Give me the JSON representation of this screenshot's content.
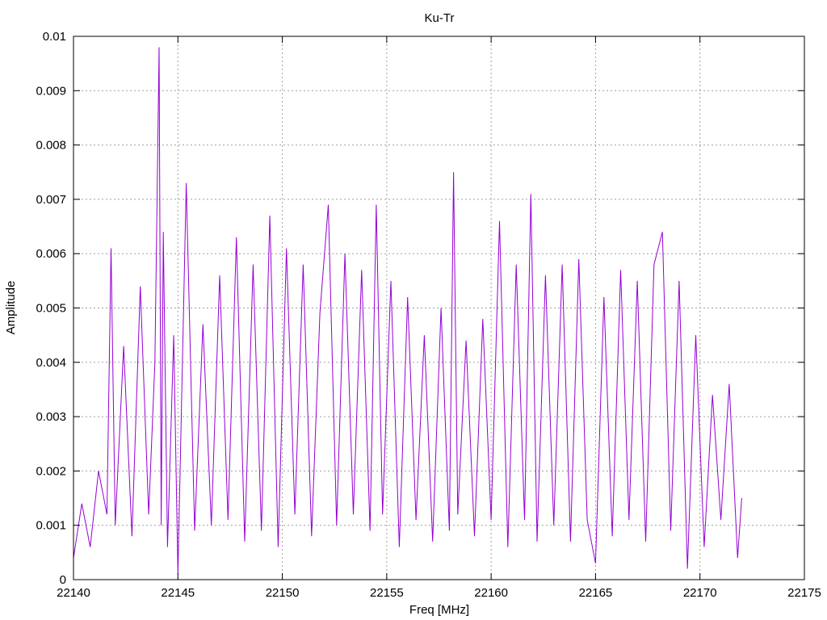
{
  "chart_data": {
    "type": "line",
    "title": "Ku-Tr",
    "xlabel": "Freq [MHz]",
    "ylabel": "Amplitude",
    "xlim": [
      22140,
      22175
    ],
    "ylim": [
      0,
      0.01
    ],
    "grid": true,
    "legend": "none",
    "x_ticks": [
      "22140",
      "22145",
      "22150",
      "22155",
      "22160",
      "22165",
      "22170",
      "22175"
    ],
    "y_ticks": [
      "0",
      "0.001",
      "0.002",
      "0.003",
      "0.004",
      "0.005",
      "0.006",
      "0.007",
      "0.008",
      "0.009",
      "0.01"
    ],
    "series_color": "#9400d3",
    "series": [
      {
        "x": [
          22140.0,
          22140.4,
          22140.8,
          22141.2,
          22141.6,
          22141.8,
          22142.0,
          22142.4,
          22142.8,
          22143.2,
          22143.6,
          22143.9,
          22144.1,
          22144.2,
          22144.3,
          22144.5,
          22144.8,
          22145.0,
          22145.4,
          22145.8,
          22146.2,
          22146.6,
          22147.0,
          22147.4,
          22147.8,
          22148.2,
          22148.6,
          22149.0,
          22149.4,
          22149.8,
          22150.2,
          22150.6,
          22151.0,
          22151.4,
          22151.8,
          22152.2,
          22152.6,
          22153.0,
          22153.4,
          22153.8,
          22154.2,
          22154.5,
          22154.8,
          22155.2,
          22155.6,
          22156.0,
          22156.4,
          22156.8,
          22157.2,
          22157.6,
          22158.0,
          22158.2,
          22158.4,
          22158.8,
          22159.2,
          22159.6,
          22160.0,
          22160.4,
          22160.8,
          22161.2,
          22161.6,
          22161.9,
          22162.2,
          22162.6,
          22163.0,
          22163.4,
          22163.8,
          22164.2,
          22164.6,
          22165.0,
          22165.4,
          22165.8,
          22166.2,
          22166.6,
          22167.0,
          22167.4,
          22167.8,
          22168.2,
          22168.6,
          22169.0,
          22169.4,
          22169.8,
          22170.2,
          22170.6,
          22171.0,
          22171.4,
          22171.8,
          22172.0
        ],
        "y": [
          0.0004,
          0.0014,
          0.0006,
          0.002,
          0.0012,
          0.0061,
          0.001,
          0.0043,
          0.0008,
          0.0054,
          0.0012,
          0.004,
          0.0098,
          0.001,
          0.0064,
          0.0006,
          0.0045,
          0.0001,
          0.0073,
          0.0009,
          0.0047,
          0.001,
          0.0056,
          0.0011,
          0.0063,
          0.0007,
          0.0058,
          0.0009,
          0.0067,
          0.0006,
          0.0061,
          0.0012,
          0.0058,
          0.0008,
          0.0049,
          0.0069,
          0.001,
          0.006,
          0.0012,
          0.0057,
          0.0009,
          0.0069,
          0.0012,
          0.0055,
          0.0006,
          0.0052,
          0.0011,
          0.0045,
          0.0007,
          0.005,
          0.0009,
          0.0075,
          0.0012,
          0.0044,
          0.0008,
          0.0048,
          0.0011,
          0.0066,
          0.0006,
          0.0058,
          0.0011,
          0.0071,
          0.0007,
          0.0056,
          0.001,
          0.0058,
          0.0007,
          0.0059,
          0.0011,
          0.0003,
          0.0052,
          0.0008,
          0.0057,
          0.0011,
          0.0055,
          0.0007,
          0.0058,
          0.0064,
          0.0009,
          0.0055,
          0.0002,
          0.0045,
          0.0006,
          0.0034,
          0.0011,
          0.0036,
          0.0004,
          0.0015
        ]
      }
    ]
  }
}
